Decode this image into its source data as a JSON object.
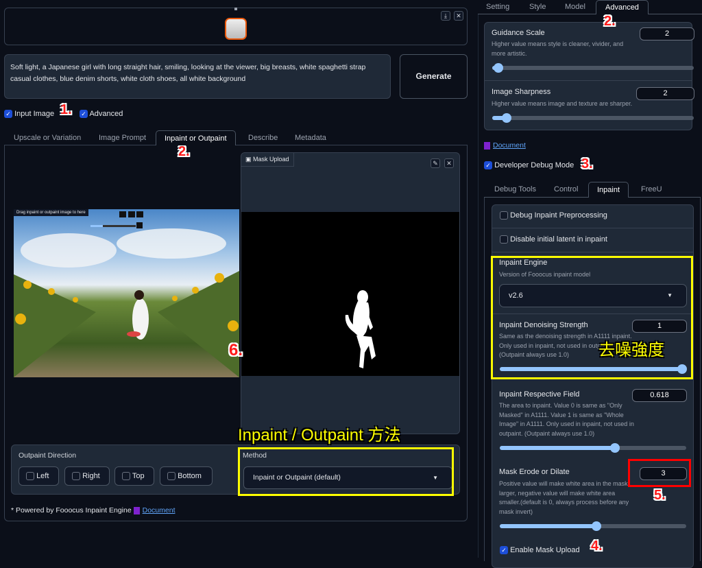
{
  "left": {
    "gallery": {
      "thumbnail": "generated-image-thumbnail",
      "download_icon": "download-icon",
      "close_icon": "close-icon"
    },
    "prompt": {
      "value": "Soft light, a Japanese girl with long straight hair, smiling, looking at the viewer, big breasts, white spaghetti strap casual clothes, blue denim shorts, white cloth shoes, all white background"
    },
    "generate_label": "Generate",
    "checkboxes": [
      {
        "label": "Input Image",
        "checked": true
      },
      {
        "label": "Advanced",
        "checked": true
      }
    ],
    "tabs": [
      {
        "label": "Upscale or Variation"
      },
      {
        "label": "Image Prompt"
      },
      {
        "label": "Inpaint or Outpaint",
        "active": true
      },
      {
        "label": "Describe"
      },
      {
        "label": "Metadata"
      }
    ],
    "canvas": {
      "hint": "Drag inpaint or outpaint image to here"
    },
    "mask_upload": {
      "label": "Mask Upload"
    },
    "outpaint": {
      "label": "Outpaint Direction",
      "options": [
        {
          "label": "Left",
          "checked": false
        },
        {
          "label": "Right",
          "checked": false
        },
        {
          "label": "Top",
          "checked": false
        },
        {
          "label": "Bottom",
          "checked": false
        }
      ]
    },
    "method": {
      "label": "Method",
      "value": "Inpaint or Outpaint (default)"
    },
    "powered": {
      "text": "* Powered by Fooocus Inpaint Engine",
      "link": "Document"
    }
  },
  "right": {
    "tabs": [
      {
        "label": "Setting"
      },
      {
        "label": "Style"
      },
      {
        "label": "Model"
      },
      {
        "label": "Advanced",
        "active": true
      }
    ],
    "guidance": {
      "label": "Guidance Scale",
      "desc": "Higher value means style is cleaner, vivider, and more artistic.",
      "value": "2",
      "slider_fraction": 0.03
    },
    "sharpness": {
      "label": "Image Sharpness",
      "desc": "Higher value means image and texture are sharper.",
      "value": "2",
      "slider_fraction": 0.07
    },
    "document_link": "Document",
    "debug_mode": {
      "label": "Developer Debug Mode",
      "checked": true
    },
    "subtabs": [
      {
        "label": "Debug Tools"
      },
      {
        "label": "Control"
      },
      {
        "label": "Inpaint",
        "active": true
      },
      {
        "label": "FreeU"
      }
    ],
    "debug_preprocessing": {
      "label": "Debug Inpaint Preprocessing",
      "checked": false
    },
    "disable_latent": {
      "label": "Disable initial latent in inpaint",
      "checked": false
    },
    "engine": {
      "label": "Inpaint Engine",
      "desc": "Version of Fooocus inpaint model",
      "value": "v2.6"
    },
    "denoise": {
      "label": "Inpaint Denoising Strength",
      "desc": "Same as the denoising strength in A1111 inpaint. Only used in inpaint, not used in outpaint. (Outpaint always use 1.0)",
      "value": "1",
      "slider_fraction": 1.0
    },
    "respective": {
      "label": "Inpaint Respective Field",
      "desc": "The area to inpaint. Value 0 is same as \"Only Masked\" in A1111. Value 1 is same as \"Whole Image\" in A1111. Only used in inpaint, not used in outpaint. (Outpaint always use 1.0)",
      "value": "0.618",
      "slider_fraction": 0.618
    },
    "erode": {
      "label": "Mask Erode or Dilate",
      "desc": "Positive value will make white area in the mask larger, negative value will make white area smaller.(default is 0, always process before any mask invert)",
      "value": "3",
      "slider_fraction": 0.52
    },
    "enable_mask": {
      "label": "Enable Mask Upload",
      "checked": true
    }
  },
  "annotations": {
    "n1": "1.",
    "n2a": "2.",
    "n2b": "2.",
    "n3": "3.",
    "n4": "4.",
    "n5": "5.",
    "n6": "6.",
    "denoise_cn": "去噪強度",
    "method_cn": "Inpaint / Outpaint 方法"
  },
  "colors": {
    "accent": "#1d4ed8",
    "slider": "#93c5fd",
    "highlight_yellow": "#ffff00",
    "highlight_red": "#ff0000"
  }
}
